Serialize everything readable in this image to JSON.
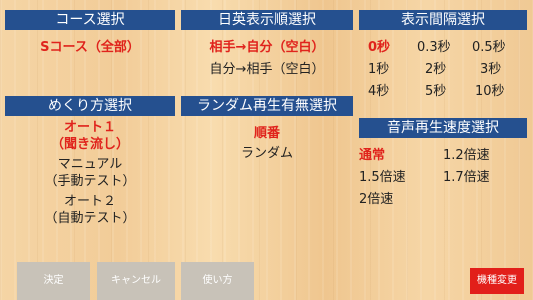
{
  "course": {
    "title": "コース選択",
    "selected": "Sコース（全部）"
  },
  "order": {
    "title": "日英表示順選択",
    "options": [
      "相手→自分（空白）",
      "自分→相手（空白）"
    ]
  },
  "interval": {
    "title": "表示間隔選択",
    "options": [
      "0秒",
      "0.3秒",
      "0.5秒",
      "1秒",
      "2秒",
      "3秒",
      "4秒",
      "5秒",
      "10秒"
    ]
  },
  "flip": {
    "title": "めくり方選択",
    "options": [
      {
        "line1": "オート１",
        "line2": "（聞き流し）"
      },
      {
        "line1": "マニュアル",
        "line2": "（手動テスト）"
      },
      {
        "line1": "オート２",
        "line2": "（自動テスト）"
      }
    ]
  },
  "random": {
    "title": "ランダム再生有無選択",
    "options": [
      "順番",
      "ランダム"
    ]
  },
  "speed": {
    "title": "音声再生速度選択",
    "options": [
      "通常",
      "1.2倍速",
      "1.5倍速",
      "1.7倍速",
      "2倍速"
    ]
  },
  "buttons": {
    "ok": "決定",
    "cancel": "キャンセル",
    "howto": "使い方",
    "change_model": "機種変更"
  },
  "colors": {
    "header": "#25508f",
    "selected": "#e0231c",
    "button": "#c8c2b8",
    "danger": "#e21f1a"
  }
}
